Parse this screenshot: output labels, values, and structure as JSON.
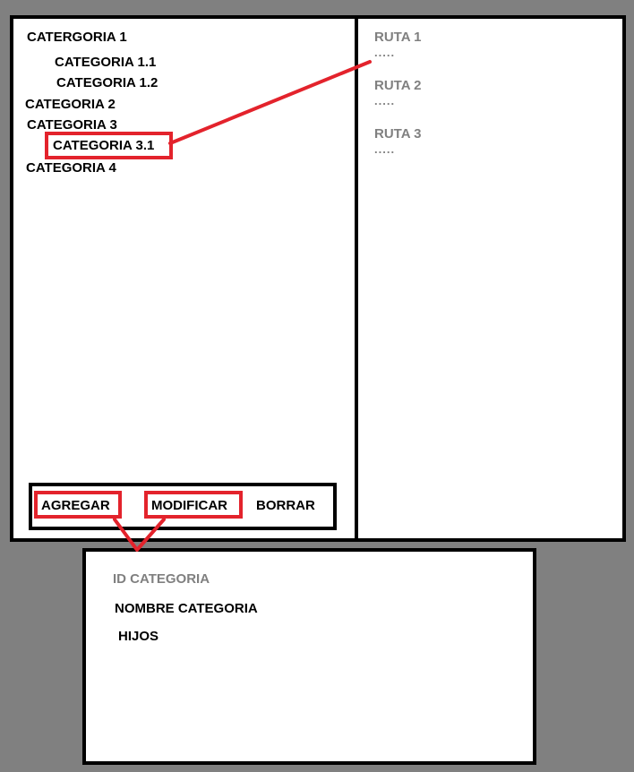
{
  "colors": {
    "background": "#808080",
    "panel": "#ffffff",
    "border": "#000000",
    "highlight": "#e3232c",
    "muted_text": "#808080"
  },
  "tree": {
    "items": [
      {
        "label": "CATERGORIA 1"
      },
      {
        "label": "CATEGORIA 1.1"
      },
      {
        "label": "CATEGORIA 1.2"
      },
      {
        "label": "CATEGORIA 2"
      },
      {
        "label": "CATEGORIA 3"
      },
      {
        "label": "CATEGORIA 3.1"
      },
      {
        "label": "CATEGORIA 4"
      }
    ]
  },
  "routes": {
    "items": [
      {
        "label": "RUTA 1",
        "detail": "....."
      },
      {
        "label": "RUTA 2",
        "detail": "....."
      },
      {
        "label": "RUTA 3",
        "detail": "....."
      }
    ]
  },
  "actions": {
    "add_label": "AGREGAR",
    "modify_label": "MODIFICAR",
    "delete_label": "BORRAR"
  },
  "form": {
    "id_label": "ID CATEGORIA",
    "name_label": "NOMBRE CATEGORIA",
    "children_label": "HIJOS"
  }
}
